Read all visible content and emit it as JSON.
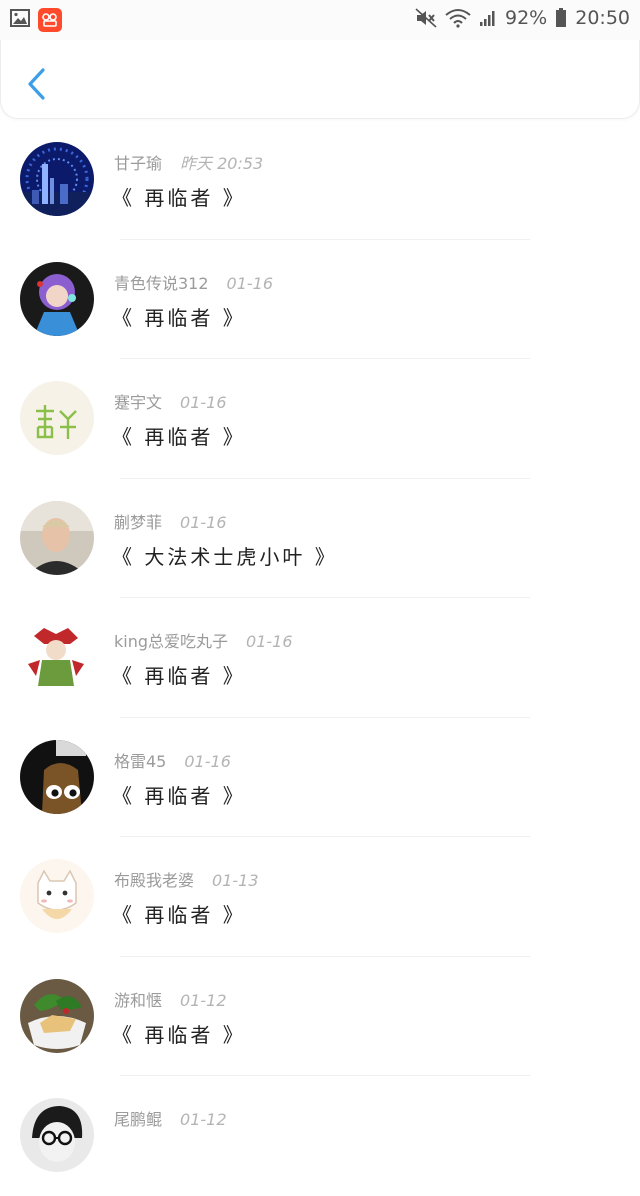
{
  "status_bar": {
    "battery": "92%",
    "time": "20:50"
  },
  "header": {
    "back_icon": "chevron-left-icon",
    "accent": "#3b9ee8"
  },
  "comments": [
    {
      "name": "甘子瑜",
      "date": "昨天  20:53",
      "text": "《 再临者 》"
    },
    {
      "name": "青色传说312",
      "date": "01-16",
      "text": "《 再临者 》"
    },
    {
      "name": "蹇宇文",
      "date": "01-16",
      "text": "《 再临者 》"
    },
    {
      "name": "蒯梦菲",
      "date": "01-16",
      "text": "《 大法术士虎小叶 》"
    },
    {
      "name": "king总爱吃丸子",
      "date": "01-16",
      "text": "《 再临者 》"
    },
    {
      "name": "格雷45",
      "date": "01-16",
      "text": "《 再临者 》"
    },
    {
      "name": "布殿我老婆",
      "date": "01-13",
      "text": "《 再临者 》"
    },
    {
      "name": "游和惬",
      "date": "01-12",
      "text": "《 再临者 》"
    },
    {
      "name": "尾鹏鲲",
      "date": "01-12",
      "text": ""
    }
  ]
}
